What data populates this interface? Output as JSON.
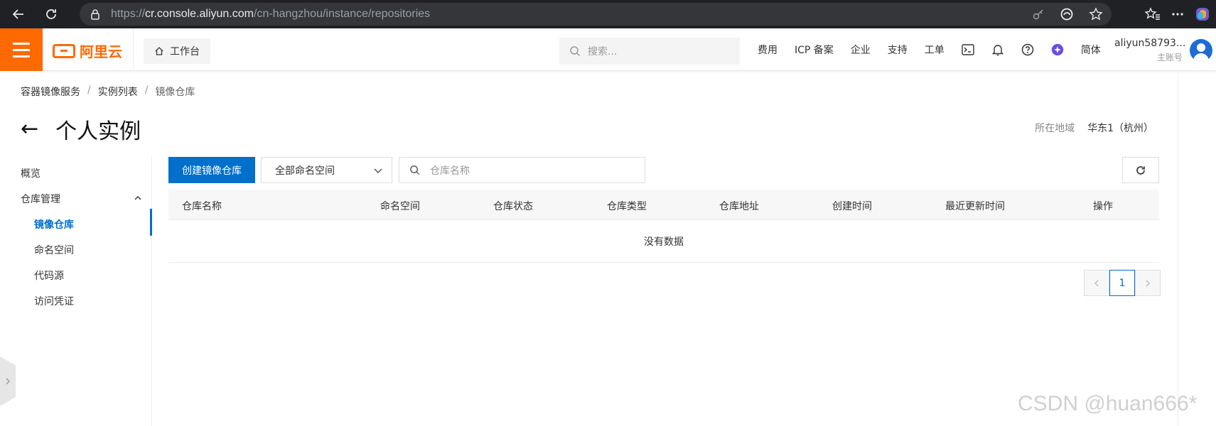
{
  "browser": {
    "url_prefix": "https://",
    "url_host": "cr.console.aliyun.com",
    "url_path": "/cn-hangzhou/instance/repositories"
  },
  "topnav": {
    "logo_text": "阿里云",
    "workbench_label": "工作台",
    "search_placeholder": "搜索...",
    "links": [
      "费用",
      "ICP 备案",
      "企业",
      "支持",
      "工单"
    ],
    "language": "简体",
    "user_name": "aliyun58793...",
    "user_role": "主账号"
  },
  "breadcrumb": {
    "items": [
      "容器镜像服务",
      "实例列表"
    ],
    "current": "镜像仓库"
  },
  "page": {
    "back_glyph": "←",
    "title": "个人实例",
    "region_label": "所在地域",
    "region_value": "华东1（杭州）"
  },
  "sidebar": {
    "overview": "概览",
    "repo_management": "仓库管理",
    "items": [
      "镜像仓库",
      "命名空间",
      "代码源",
      "访问凭证"
    ],
    "active_item": "镜像仓库"
  },
  "toolbar": {
    "create_label": "创建镜像仓库",
    "namespace_selected": "全部命名空间",
    "search_placeholder": "仓库名称"
  },
  "table": {
    "columns": [
      "仓库名称",
      "命名空间",
      "仓库状态",
      "仓库类型",
      "仓库地址",
      "创建时间",
      "最近更新时间",
      "操作"
    ],
    "empty_text": "没有数据"
  },
  "pagination": {
    "current_page": "1"
  },
  "watermark": "CSDN @huan666*",
  "colors": {
    "brand_orange": "#ff6a00",
    "primary_blue": "#0070cc"
  }
}
